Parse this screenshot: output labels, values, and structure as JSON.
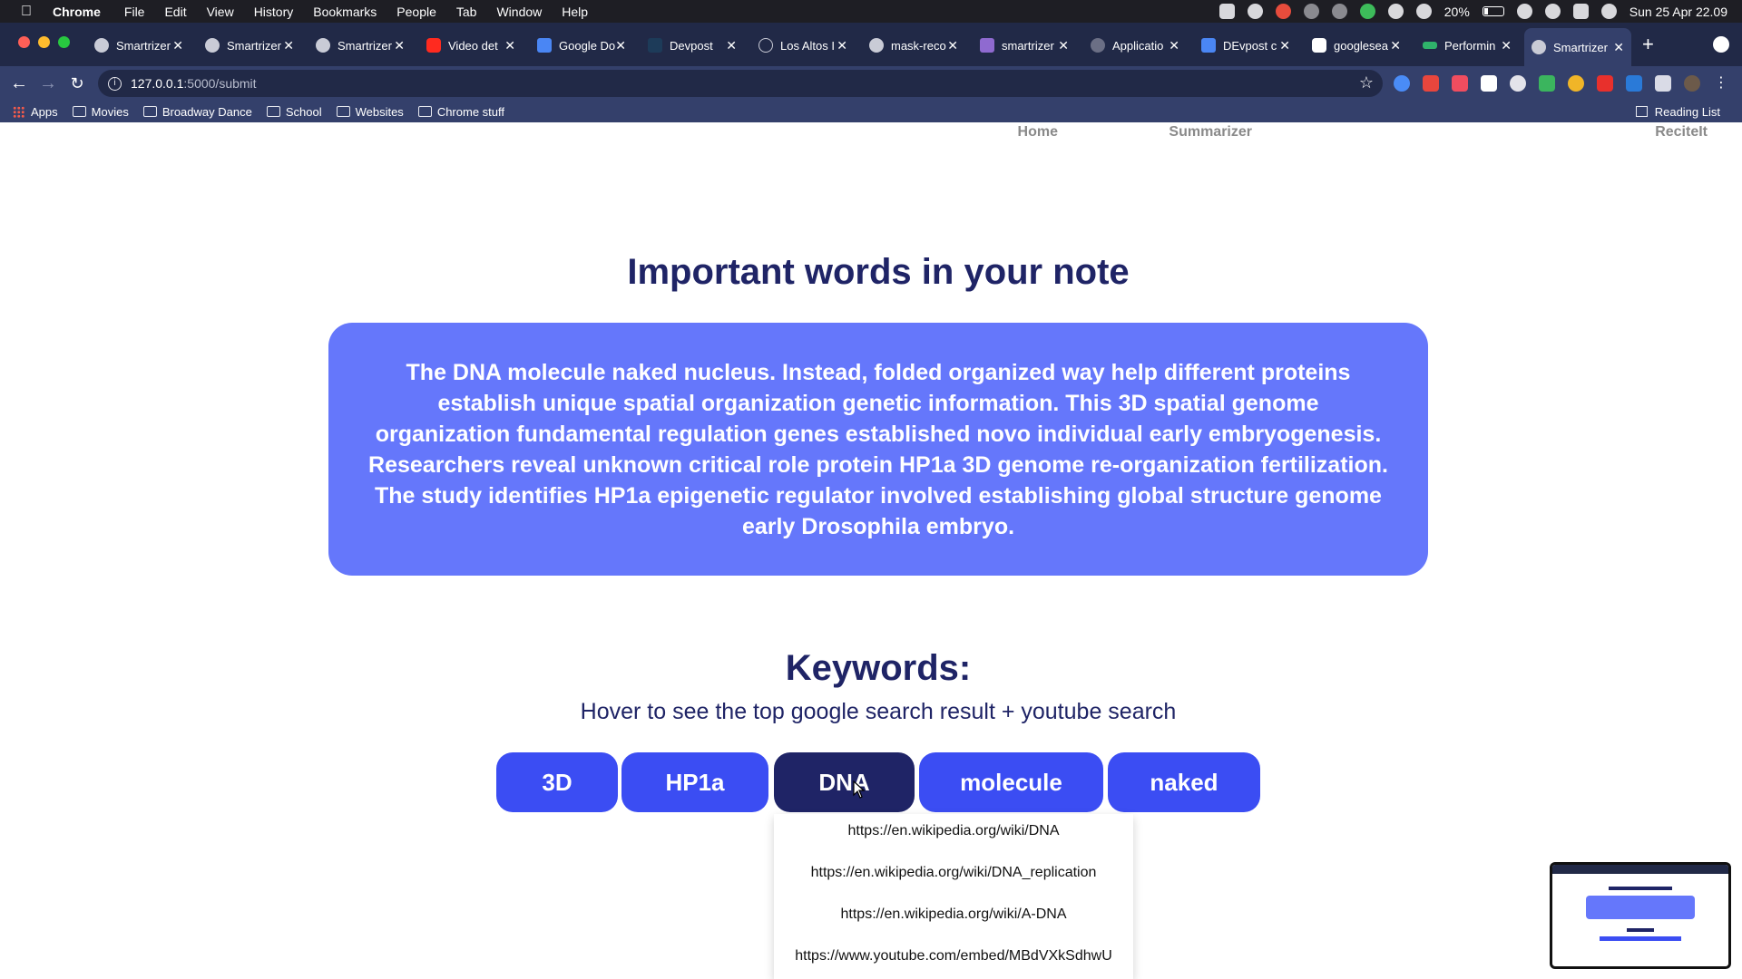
{
  "menubar": {
    "app_name": "Chrome",
    "items": [
      "File",
      "Edit",
      "View",
      "History",
      "Bookmarks",
      "People",
      "Tab",
      "Window",
      "Help"
    ],
    "battery": "20%",
    "datetime": "Sun 25 Apr  22.09"
  },
  "tabs": [
    {
      "label": "Smartrizer"
    },
    {
      "label": "Smartrizer"
    },
    {
      "label": "Smartrizer"
    },
    {
      "label": "Video det"
    },
    {
      "label": "Google Do"
    },
    {
      "label": "Devpost"
    },
    {
      "label": "Los Altos I"
    },
    {
      "label": "mask-reco"
    },
    {
      "label": "smartrizer"
    },
    {
      "label": "Applicatio"
    },
    {
      "label": "DEvpost c"
    },
    {
      "label": "googlesea"
    },
    {
      "label": "Performin"
    },
    {
      "label": "Smartrizer"
    }
  ],
  "address_bar": {
    "host": "127.0.0.1",
    "rest": ":5000/submit"
  },
  "bookmarks": {
    "apps": "Apps",
    "items": [
      "Movies",
      "Broadway Dance",
      "School",
      "Websites",
      "Chrome stuff"
    ],
    "reading_list": "Reading List"
  },
  "site_nav": {
    "home": "Home",
    "summarizer": "Summarizer",
    "reciteit": "ReciteIt"
  },
  "page": {
    "title": "Important words in your note",
    "note": "The DNA molecule naked nucleus. Instead, folded organized way help different proteins establish unique spatial organization genetic information. This 3D spatial genome organization fundamental regulation genes established novo individual early embryogenesis. Researchers reveal unknown critical role protein HP1a 3D genome re-organization fertilization. The study identifies HP1a epigenetic regulator involved establishing global structure genome early Drosophila embryo.",
    "keywords_title": "Keywords:",
    "keywords_hint": "Hover to see the top google search result + youtube search",
    "keywords": [
      "3D",
      "HP1a",
      "DNA",
      "molecule",
      "naked"
    ],
    "active_keyword": "DNA",
    "dropdown_links": [
      "https://en.wikipedia.org/wiki/DNA",
      "https://en.wikipedia.org/wiki/DNA_replication",
      "https://en.wikipedia.org/wiki/A-DNA",
      "https://www.youtube.com/embed/MBdVXkSdhwU"
    ]
  },
  "colors": {
    "accent": "#3b4df3",
    "accent_active": "#1f2466",
    "note_bg": "#6577fb",
    "chrome_dark": "#212947",
    "chrome_toolbar": "#34406b"
  }
}
